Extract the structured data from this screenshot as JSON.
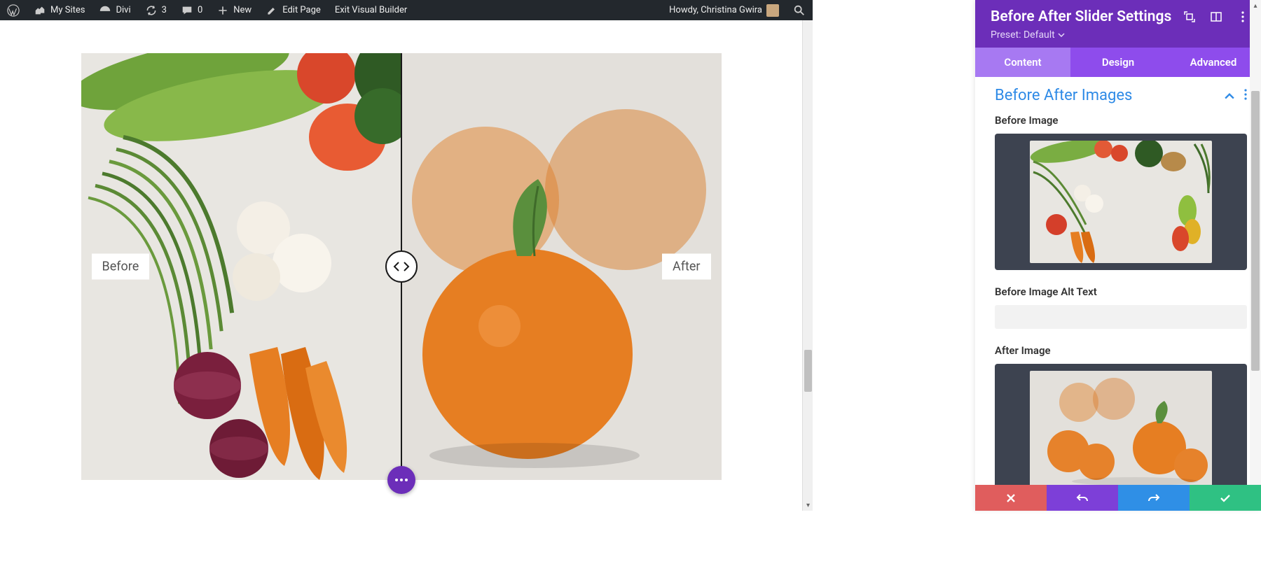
{
  "wp_bar": {
    "my_sites": "My Sites",
    "site_name": "Divi",
    "updates": "3",
    "comments": "0",
    "new": "New",
    "edit_page": "Edit Page",
    "exit_vb": "Exit Visual Builder",
    "howdy": "Howdy, Christina Gwira"
  },
  "slider": {
    "before_label": "Before",
    "after_label": "After"
  },
  "panel": {
    "title": "Before After Slider Settings",
    "preset_label": "Preset: Default",
    "tabs": {
      "content": "Content",
      "design": "Design",
      "advanced": "Advanced"
    },
    "section_title": "Before After Images",
    "before_image_label": "Before Image",
    "before_alt_label": "Before Image Alt Text",
    "before_alt_value": "",
    "after_image_label": "After Image"
  }
}
